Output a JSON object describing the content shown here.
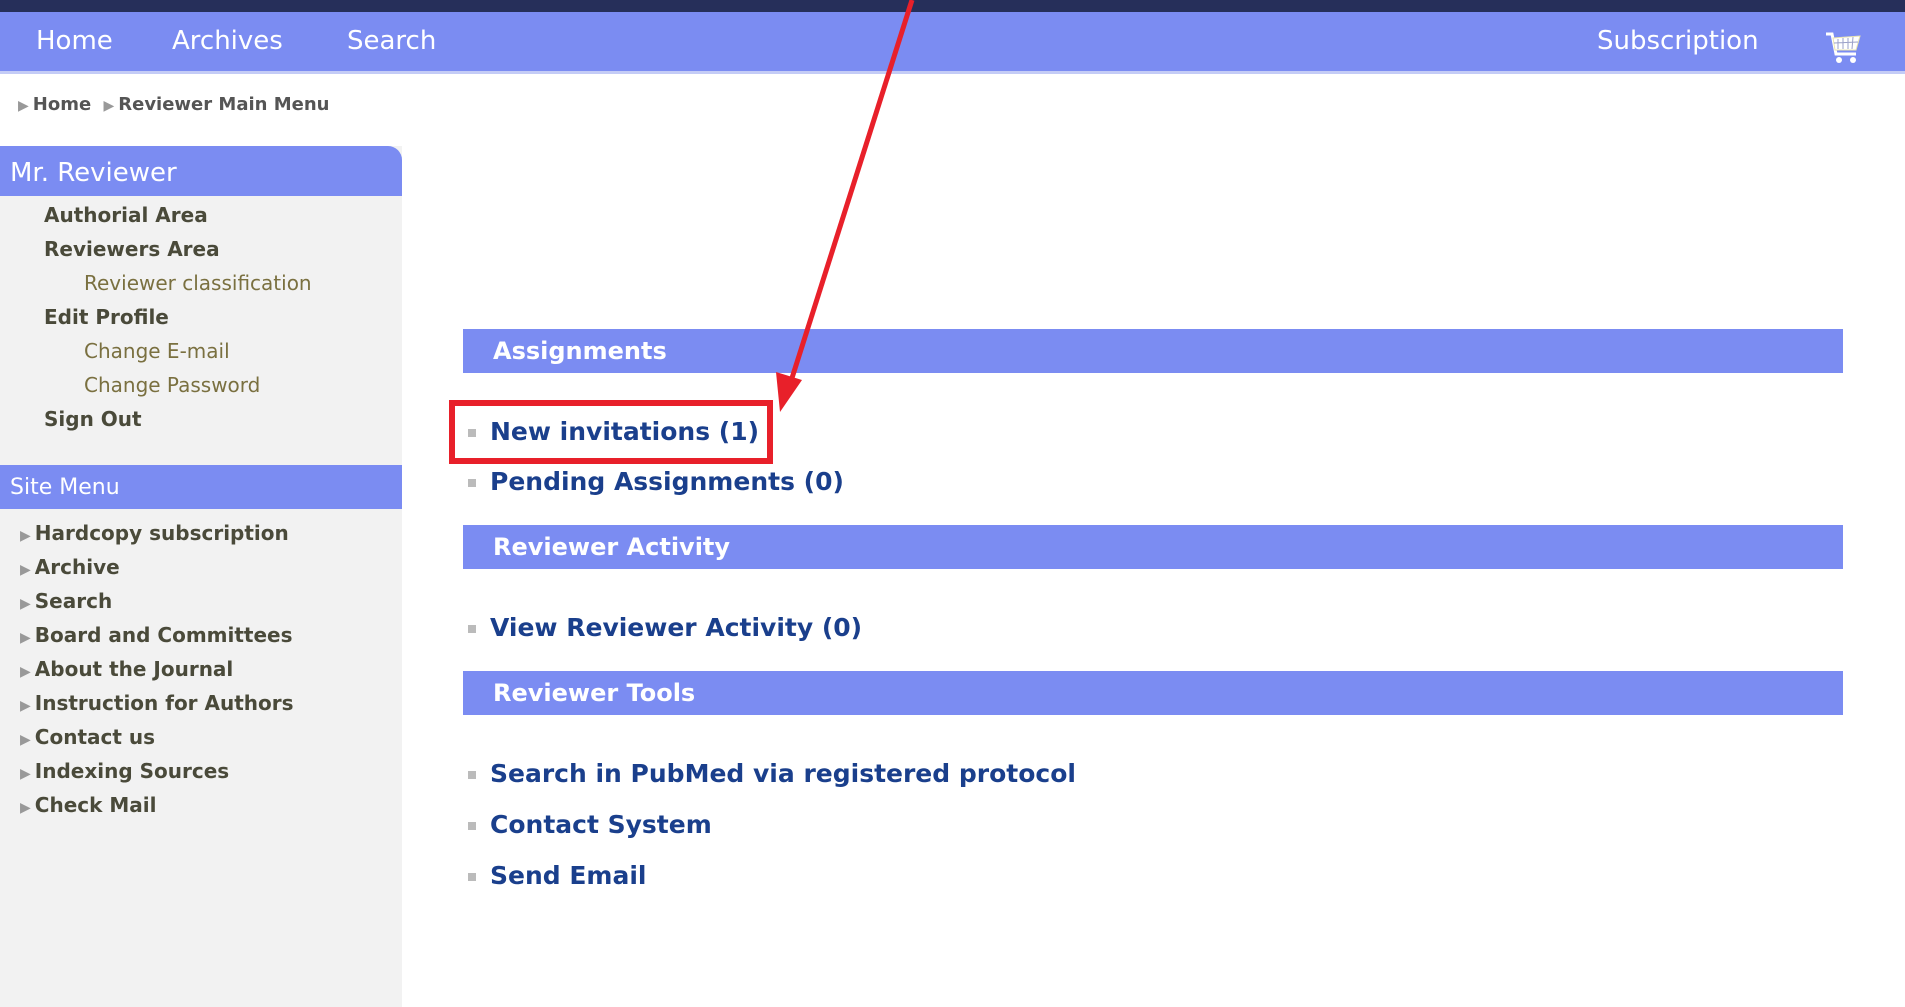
{
  "nav": {
    "home": "Home",
    "archives": "Archives",
    "search": "Search",
    "subscription": "Subscription",
    "cart_icon": "shopping-cart-icon"
  },
  "breadcrumb": {
    "items": [
      "Home",
      "Reviewer Main Menu"
    ]
  },
  "sidebar": {
    "user_title": "Mr. Reviewer",
    "authorial_area": "Authorial Area",
    "reviewers_area": "Reviewers Area",
    "reviewer_classification": "Reviewer classification",
    "edit_profile": "Edit Profile",
    "change_email": "Change E-mail",
    "change_password": "Change Password",
    "sign_out": "Sign Out",
    "site_menu_title": "Site Menu",
    "site_menu": [
      "Hardcopy subscription",
      "Archive",
      "Search",
      "Board and Committees",
      "About the Journal",
      "Instruction for Authors",
      "Contact us",
      "Indexing Sources",
      "Check Mail"
    ]
  },
  "main": {
    "assignments_title": "Assignments",
    "new_invitations": "New invitations (1)",
    "pending_assignments": "Pending Assignments (0)",
    "activity_title": "Reviewer Activity",
    "view_activity": "View Reviewer Activity (0)",
    "tools_title": "Reviewer Tools",
    "search_pubmed": "Search in PubMed via registered protocol",
    "contact_system": "Contact System",
    "send_email": "Send Email"
  },
  "colors": {
    "nav_bg": "#7b8cf2",
    "link_blue": "#1a3f8c",
    "annotation_red": "#e8202a",
    "sidebar_bg": "#f2f2f2"
  }
}
